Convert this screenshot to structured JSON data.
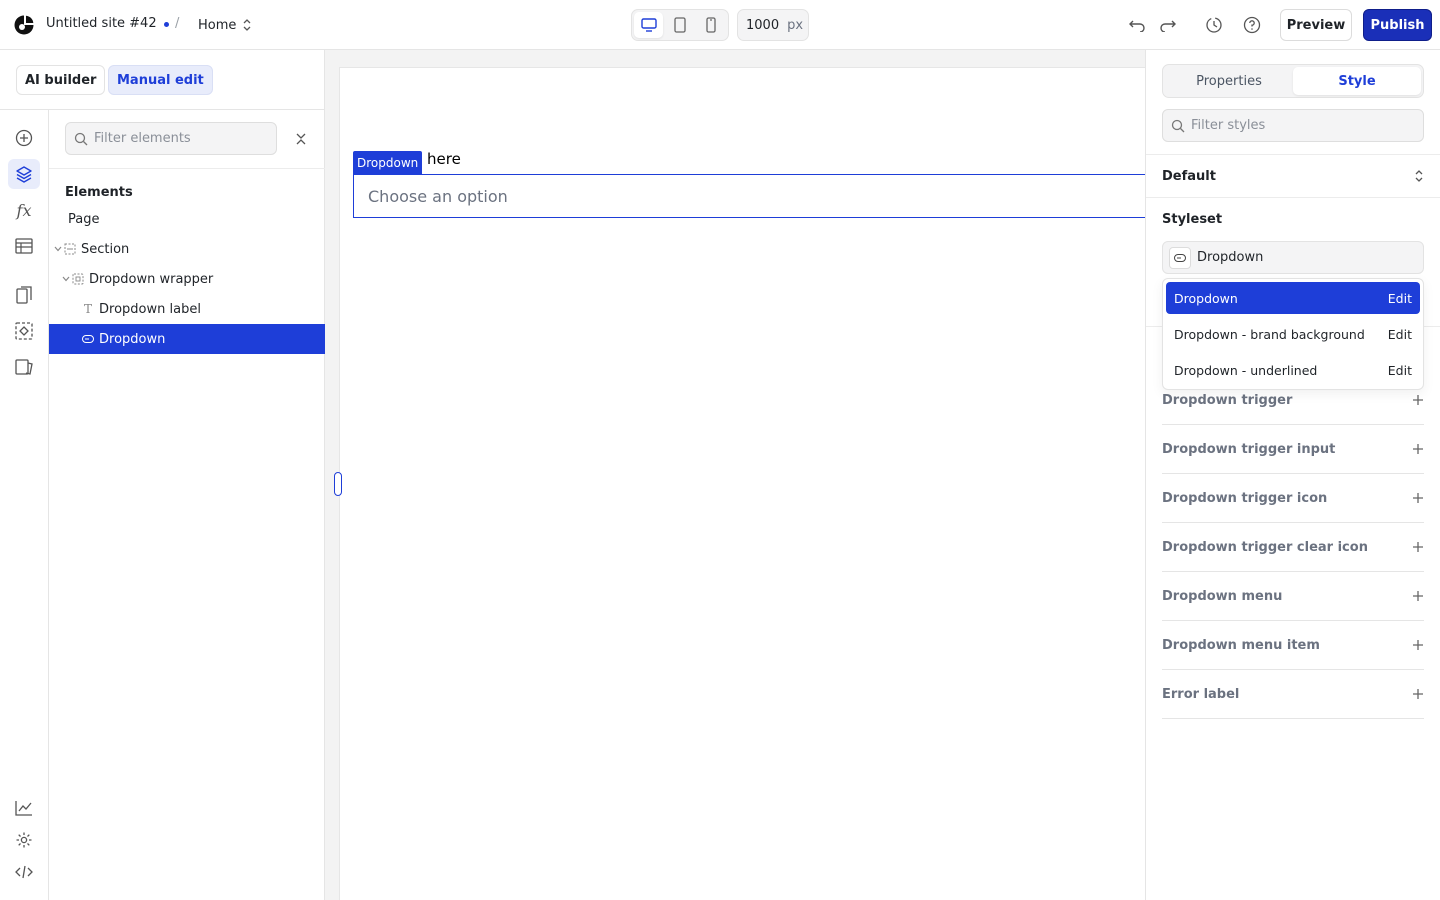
{
  "topbar": {
    "site_name": "Untitled site #42",
    "separator": "/",
    "page": "Home",
    "canvas_width": "1000",
    "canvas_unit": "px",
    "preview_label": "Preview",
    "publish_label": "Publish"
  },
  "modes": {
    "ai_builder": "AI builder",
    "manual_edit": "Manual edit"
  },
  "elements_panel": {
    "filter_placeholder": "Filter elements",
    "title": "Elements",
    "tree": [
      {
        "label": "Page"
      },
      {
        "label": "Section"
      },
      {
        "label": "Dropdown wrapper"
      },
      {
        "label": "Dropdown label"
      },
      {
        "label": "Dropdown"
      }
    ]
  },
  "canvas": {
    "selection_tag": "Dropdown",
    "label_text": "here",
    "dropdown_placeholder": "Choose an option"
  },
  "style_panel": {
    "tabs": [
      "Properties",
      "Style"
    ],
    "active_tab": "Style",
    "filter_placeholder": "Filter styles",
    "state": "Default",
    "styleset_title": "Styleset",
    "styleset_selected": "Dropdown",
    "styleset_options": [
      {
        "label": "Dropdown",
        "action": "Edit"
      },
      {
        "label": "Dropdown - brand background",
        "action": "Edit"
      },
      {
        "label": "Dropdown - underlined",
        "action": "Edit"
      }
    ],
    "subelements": [
      "Dropdown trigger",
      "Dropdown trigger input",
      "Dropdown trigger icon",
      "Dropdown trigger clear icon",
      "Dropdown menu",
      "Dropdown menu item",
      "Error label"
    ]
  },
  "colors": {
    "accent": "#1e3ed8",
    "publish": "#1a2fb8"
  }
}
